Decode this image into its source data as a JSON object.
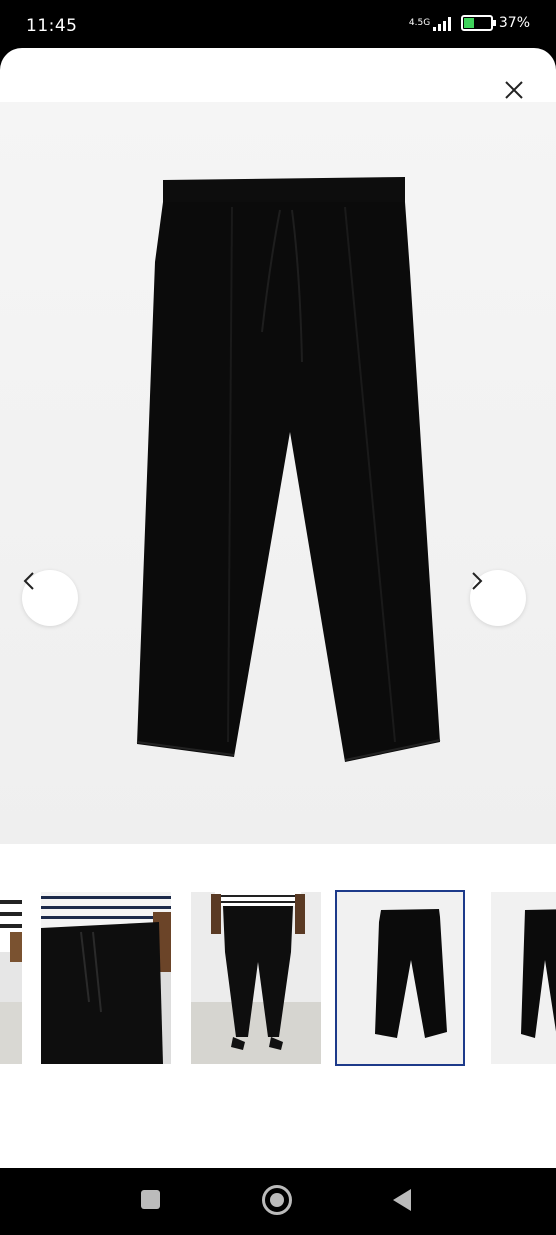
{
  "status_bar": {
    "time": "11:45",
    "network": "4.5G",
    "battery_percent": "37%",
    "battery_level": 0.37,
    "icons": [
      "signal-icon",
      "battery-charging-icon"
    ]
  },
  "viewer": {
    "close_icon": "close-icon",
    "prev_icon": "chevron-left-icon",
    "next_icon": "chevron-right-icon",
    "main_image": "black-pull-on-trousers-product-image",
    "thumbnails": [
      {
        "image": "striped-top-model-cropped"
      },
      {
        "image": "drawstring-waist-closeup"
      },
      {
        "image": "model-back-view-full-length"
      },
      {
        "image": "trousers-flat-lay",
        "selected": true
      },
      {
        "image": "trousers-flat-lay-partial"
      }
    ]
  },
  "system_nav": {
    "icons": [
      "recents-square-icon",
      "home-circle-icon",
      "back-triangle-icon"
    ]
  },
  "colors": {
    "selected_border": "#1d3a8a",
    "image_bg": "#f2f2f2",
    "garment": "#0b0b0b"
  }
}
